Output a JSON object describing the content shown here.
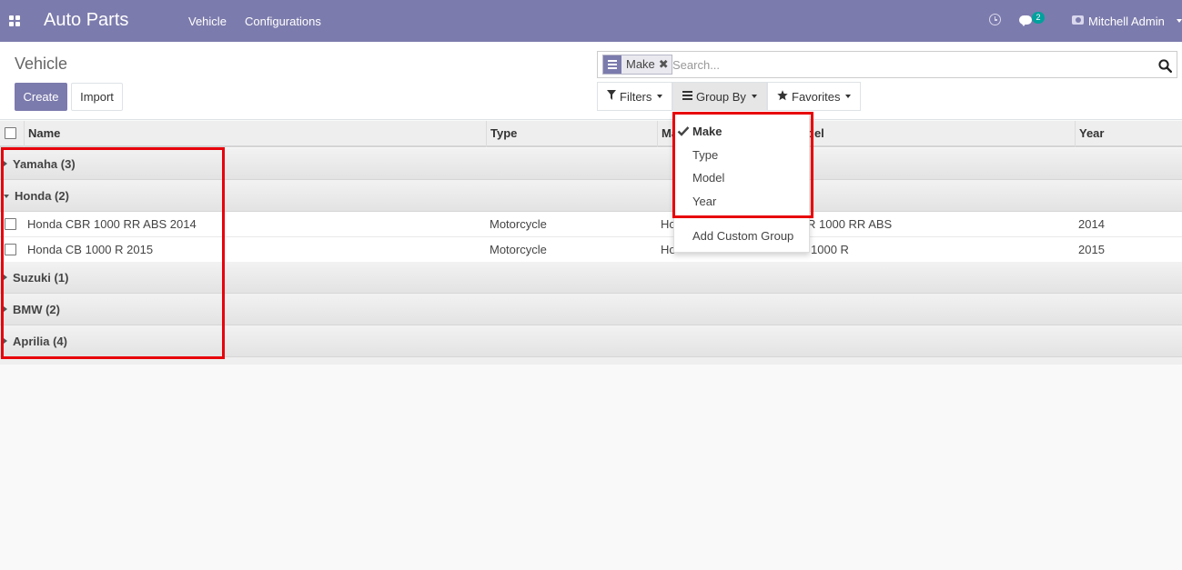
{
  "app": {
    "title": "Auto Parts",
    "menu": [
      "Vehicle",
      "Configurations"
    ],
    "chat_count": "2",
    "user_name": "Mitchell Admin"
  },
  "control_panel": {
    "title": "Vehicle",
    "create_label": "Create",
    "import_label": "Import",
    "search": {
      "facet": "Make",
      "placeholder": "Search..."
    },
    "filters_label": "Filters",
    "groupby_label": "Group By",
    "favorites_label": "Favorites"
  },
  "groupby_menu": {
    "items": [
      "Make",
      "Type",
      "Model",
      "Year"
    ],
    "selected": "Make",
    "custom": "Add Custom Group"
  },
  "list": {
    "columns": [
      "Name",
      "Type",
      "Ma",
      "del",
      "Year"
    ],
    "groups": [
      {
        "label": "Yamaha (3)",
        "expanded": false
      },
      {
        "label": "Honda (2)",
        "expanded": true
      },
      {
        "label": "Suzuki (1)",
        "expanded": false
      },
      {
        "label": "BMW (2)",
        "expanded": false
      },
      {
        "label": "Aprilia (4)",
        "expanded": false
      }
    ],
    "rows": [
      {
        "name": "Honda CBR 1000 RR ABS 2014",
        "type": "Motorcycle",
        "make": "Hon",
        "model": "R 1000 RR ABS",
        "year": "2014"
      },
      {
        "name": "Honda CB 1000 R 2015",
        "type": "Motorcycle",
        "make": "Ho",
        "model": "1000 R",
        "year": "2015"
      }
    ]
  },
  "colors": {
    "navbar": "#7c7bad",
    "primary": "#7c7bad",
    "annotation": "#e8000b",
    "badge": "#00a09d"
  }
}
